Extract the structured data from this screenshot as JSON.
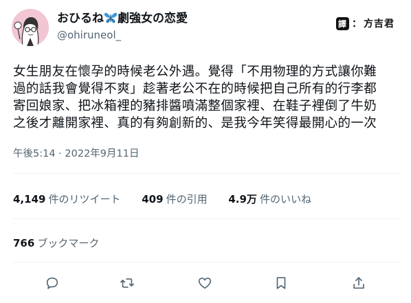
{
  "tweet": {
    "author": {
      "display_name": "おひるね",
      "display_name_suffix": "劇強女の恋愛",
      "handle": "@ohiruneol_"
    },
    "watermark": {
      "tag": "譯",
      "separator": "：",
      "name": "方吉君"
    },
    "body_lines": [
      "女生朋友在懷孕的時候老公外遇。覺得「不用物理的方式讓你難",
      "過的話我會覺得不爽」趁著老公不在的時候把自己所有的行李都",
      "寄回娘家、把冰箱裡的豬排醬噴滿整個家裡、在鞋子裡倒了牛奶",
      "之後才離開家裡、真的有夠創新的、是我今年笑得最開心的一次"
    ],
    "timestamp": "午後5:14 · 2022年9月11日",
    "stats": {
      "retweets": {
        "value": "4,149",
        "label": "件のリツイート"
      },
      "quotes": {
        "value": "409",
        "label": "件の引用"
      },
      "likes": {
        "value": "4.9万",
        "label": "件のいいね"
      }
    },
    "bookmarks": {
      "value": "766",
      "label": "ブックマーク"
    },
    "colors": {
      "text": "#0f1419",
      "secondary": "#536471",
      "divider": "#eff3f4",
      "butterfly": "#3a9ad9",
      "avatar_bg": "#f3c6d3"
    },
    "icons": {
      "reply": "speech-bubble-icon",
      "retweet": "retweet-arrows-icon",
      "like": "heart-icon",
      "bookmark": "bookmark-icon",
      "share": "share-upload-icon"
    }
  }
}
